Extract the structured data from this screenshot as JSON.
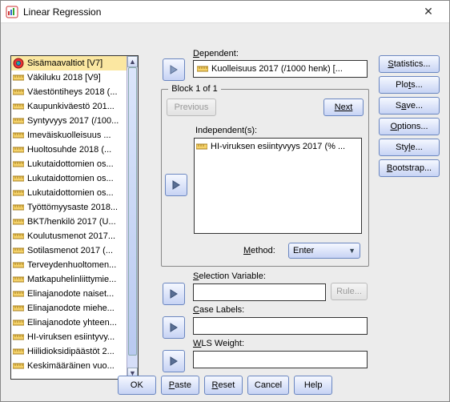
{
  "window": {
    "title": "Linear Regression"
  },
  "varlist": {
    "items": [
      "Sisämaavaltiot [V7]",
      "Väkiluku 2018 [V9]",
      "Väestöntiheys 2018 (...",
      "Kaupunkiväestö 201...",
      "Syntyvyys 2017 (/100...",
      "Imeväiskuolleisuus ...",
      "Huoltosuhde 2018 (...",
      "Lukutaidottomien os...",
      "Lukutaidottomien os...",
      "Lukutaidottomien os...",
      "Työttömyysaste 2018...",
      "BKT/henkilö 2017 (U...",
      "Koulutusmenot 2017...",
      "Sotilasmenot 2017 (...",
      "Terveydenhuoltomen...",
      "Matkapuhelinliittymie...",
      "Elinajanodote naiset...",
      "Elinajanodote miehe...",
      "Elinajanodote yhteen...",
      "HI-viruksen esiintyvy...",
      "Hiilidioksidipäästöt 2...",
      "Keskimääräinen vuo..."
    ],
    "first_is_nominal": true,
    "selected_index": 0
  },
  "labels": {
    "dependent": "Dependent:",
    "block": "Block 1 of 1",
    "previous": "Previous",
    "next": "Next",
    "independent": "Independent(s):",
    "method": "Method:",
    "selection_var": "Selection Variable:",
    "rule": "Rule...",
    "case_labels": "Case Labels:",
    "wls_weight": "WLS Weight:"
  },
  "dependent": {
    "value": "Kuolleisuus 2017 (/1000 henk) [..."
  },
  "independent": {
    "items": [
      "HI-viruksen esiintyvyys 2017 (% ..."
    ]
  },
  "method": {
    "value": "Enter"
  },
  "selection_variable": {
    "value": ""
  },
  "case_labels": {
    "value": ""
  },
  "wls_weight": {
    "value": ""
  },
  "side_buttons": {
    "statistics": "Statistics...",
    "plots": "Plots...",
    "save": "Save...",
    "options": "Options...",
    "style": "Style...",
    "bootstrap": "Bootstrap..."
  },
  "bottom": {
    "ok": "OK",
    "paste": "Paste",
    "reset": "Reset",
    "cancel": "Cancel",
    "help": "Help"
  }
}
